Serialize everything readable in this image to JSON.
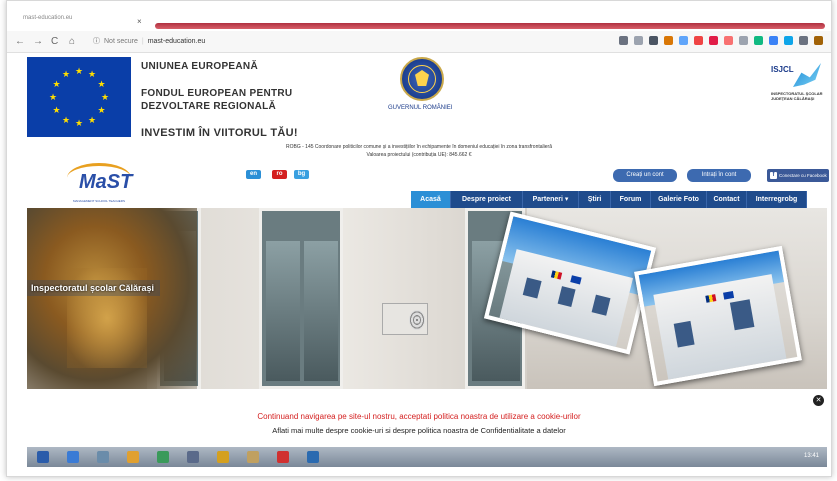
{
  "browser": {
    "tab_title": "mast-education.eu",
    "tab_close": "×",
    "nav": {
      "back": "←",
      "forward": "→",
      "reload": "C",
      "home": "⌂"
    },
    "security_icon": "info-circle-icon",
    "security_label": "Not secure",
    "url": "mast-education.eu",
    "extension_colors": [
      "#6b7280",
      "#9ca3af",
      "#4b5563",
      "#d97706",
      "#60a5fa",
      "#ef4444",
      "#e11d48",
      "#f87171",
      "#9ca3af",
      "#10b981",
      "#3b82f6",
      "#0ea5e9",
      "#6b7280",
      "#a16207"
    ]
  },
  "header": {
    "eu_title": "UNIUNEA EUROPEANĂ",
    "fund_line1": "FONDUL EUROPEAN PENTRU",
    "fund_line2": "DEZVOLTARE REGIONALĂ",
    "slogan": "INVESTIM ÎN VIITORUL TĂU!",
    "gov_label": "GUVERNUL ROMÂNIEI",
    "isj_label": "ISJCL",
    "isj_sub": "INSPECTORATUL ŞCOLAR JUDEŢEAN CĂLĂRAŞI",
    "project_line1": "ROBG - 145 Coordonare politicilor comune și a investițiilor în echipamente în domeniul educației în zona transfrontalieră",
    "project_line2": "Valoarea proiectului (contribuția UE): 845.662 €",
    "mast_logo_text": "MaST",
    "mast_logo_foot": "MANAGEMENT SCHOOL TEACHERS"
  },
  "languages": [
    {
      "code": "en",
      "color": "#2b8fd6"
    },
    {
      "code": "ro",
      "color": "#d42020"
    },
    {
      "code": "bg",
      "color": "#3aa0e0"
    }
  ],
  "account": {
    "create": "Creați un cont",
    "login": "Intrați în cont",
    "facebook": "Conectare cu Facebook"
  },
  "menu": [
    {
      "label": "Acasă",
      "active": true
    },
    {
      "label": "Despre proiect",
      "active": false
    },
    {
      "label": "Parteneri ▾",
      "active": false
    },
    {
      "label": "Știri",
      "active": false
    },
    {
      "label": "Forum",
      "active": false
    },
    {
      "label": "Galerie Foto",
      "active": false
    },
    {
      "label": "Contact",
      "active": false
    },
    {
      "label": "Interregrobg",
      "active": false
    }
  ],
  "hero": {
    "caption": "Inspectoratul școlar Călărași"
  },
  "cookie": {
    "line1": "Continuand navigarea pe site-ul nostru, acceptati politica noastra de utilizare a cookie-urilor",
    "line2": "Aflati mai multe despre cookie-uri si despre politica noastra de Confidentialitate a datelor",
    "close": "✕"
  },
  "taskbar": {
    "icon_colors": [
      "#2a5caa",
      "#3a7bd5",
      "#6a8caa",
      "#e0a030",
      "#3a9a5a",
      "#5a6a8a",
      "#d4a020",
      "#c0a060",
      "#d03030",
      "#2a6ab0"
    ],
    "clock": "13:41"
  }
}
